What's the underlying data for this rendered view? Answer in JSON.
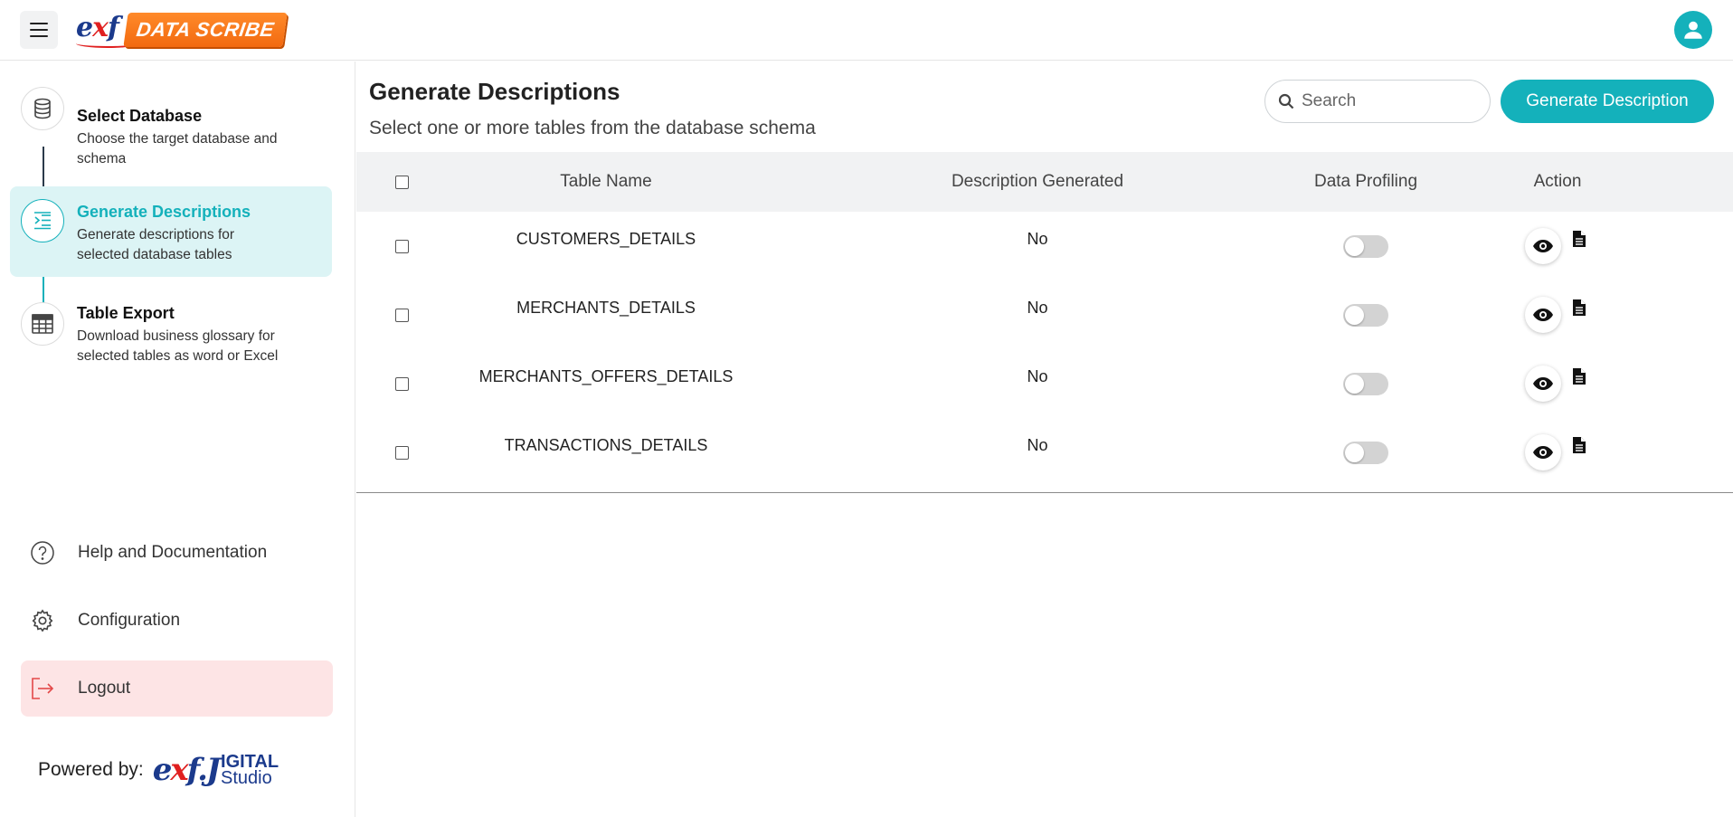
{
  "header": {
    "logo_text_e": "e",
    "logo_text_x": "x",
    "logo_text_f": "f",
    "logo_badge": "DATA SCRIBE"
  },
  "sidebar": {
    "steps": [
      {
        "title": "Select Database",
        "description": "Choose the target database and schema",
        "icon": "database-icon"
      },
      {
        "title": "Generate Descriptions",
        "description": "Generate descriptions for selected database tables",
        "icon": "list-indent-icon",
        "active": true
      },
      {
        "title": "Table Export",
        "description": "Download business glossary for selected tables as word or Excel",
        "icon": "table-icon"
      }
    ],
    "links": [
      {
        "label": "Help and Documentation",
        "icon": "help-circle-icon"
      },
      {
        "label": "Configuration",
        "icon": "gear-icon"
      },
      {
        "label": "Logout",
        "icon": "logout-icon"
      }
    ],
    "powered_by": "Powered by:",
    "powered_logo_e": "e",
    "powered_logo_x": "x",
    "powered_logo_f": "f.",
    "powered_logo_j": "J",
    "powered_logo_digital": "IGITAL",
    "powered_logo_studio": "Studio"
  },
  "main": {
    "title": "Generate Descriptions",
    "subtitle": "Select one or more tables from the database schema",
    "search_placeholder": "Search",
    "generate_button": "Generate Description",
    "table": {
      "headers": {
        "name": "Table Name",
        "description": "Description Generated",
        "profiling": "Data Profiling",
        "action": "Action"
      },
      "rows": [
        {
          "name": "CUSTOMERS_DETAILS",
          "description_generated": "No",
          "data_profiling": false
        },
        {
          "name": "MERCHANTS_DETAILS",
          "description_generated": "No",
          "data_profiling": false
        },
        {
          "name": "MERCHANTS_OFFERS_DETAILS",
          "description_generated": "No",
          "data_profiling": false
        },
        {
          "name": "TRANSACTIONS_DETAILS",
          "description_generated": "No",
          "data_profiling": false
        }
      ]
    }
  },
  "colors": {
    "accent": "#14b1bb",
    "active_bg": "#dcf4f5",
    "logout_bg": "#fde4e5",
    "logout_icon": "#e34848",
    "badge_orange": "#f26a10",
    "brand_blue": "#1b3a8c",
    "brand_red": "#e02020"
  }
}
